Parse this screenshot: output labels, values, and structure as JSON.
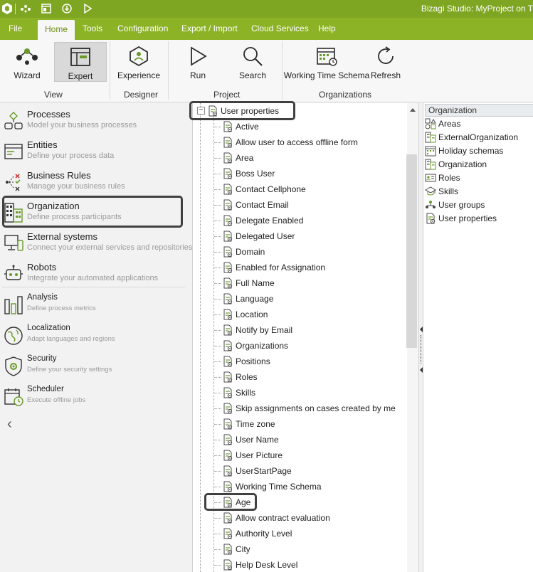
{
  "window": {
    "title": "Bizagi Studio: MyProject  on T"
  },
  "quick_access": [
    "bizagi-logo-icon",
    "workflow-icon",
    "window-icon",
    "download-icon",
    "play-icon"
  ],
  "menu": {
    "items": [
      "File",
      "Home",
      "Tools",
      "Configuration",
      "Export / Import",
      "Cloud Services",
      "Help"
    ],
    "active": "Home"
  },
  "ribbon": {
    "buttons": {
      "wizard": "Wizard",
      "expert": "Expert",
      "experience": "Experience",
      "run": "Run",
      "search": "Search",
      "working_time_schema": "Working Time Schema",
      "refresh": "Refresh"
    },
    "groups": {
      "view": "View",
      "designer": "Designer",
      "project": "Project",
      "organizations": "Organizations"
    }
  },
  "nav": {
    "items": [
      {
        "title": "Processes",
        "subtitle": "Model your business processes"
      },
      {
        "title": "Entities",
        "subtitle": "Define your process data"
      },
      {
        "title": "Business Rules",
        "subtitle": "Manage your business rules"
      },
      {
        "title": "Organization",
        "subtitle": "Define process participants"
      },
      {
        "title": "External systems",
        "subtitle": "Connect your external services and repositories"
      },
      {
        "title": "Robots",
        "subtitle": "Integrate your automated applications"
      },
      {
        "title": "Analysis",
        "subtitle": "Define process metrics"
      },
      {
        "title": "Localization",
        "subtitle": "Adapt languages and regions"
      },
      {
        "title": "Security",
        "subtitle": "Define your security settings"
      },
      {
        "title": "Scheduler",
        "subtitle": "Execute offline jobs"
      }
    ],
    "collapse_glyph": "‹"
  },
  "tree": {
    "root": "User properties",
    "expander": "⊟",
    "children": [
      "Active",
      "Allow user to access offline form",
      "Area",
      "Boss User",
      "Contact Cellphone",
      "Contact Email",
      "Delegate Enabled",
      "Delegated User",
      "Domain",
      "Enabled for Assignation",
      "Full Name",
      "Language",
      "Location",
      "Notify by Email",
      "Organizations",
      "Positions",
      "Roles",
      "Skills",
      "Skip assignments on cases created by me",
      "Time zone",
      "User Name",
      "User Picture",
      "UserStartPage",
      "Working Time Schema",
      "Age",
      "Allow contract evaluation",
      "Authority Level",
      "City",
      "Help Desk Level"
    ]
  },
  "right_panel": {
    "header": "Organization",
    "items": [
      "Areas",
      "ExternalOrganization",
      "Holiday schemas",
      "Organization",
      "Roles",
      "Skills",
      "User groups",
      "User properties"
    ]
  },
  "colors": {
    "titlebar": "#7fa622",
    "menubar": "#8cb225",
    "highlight_border": "#404040",
    "accent": "#8cb225"
  }
}
